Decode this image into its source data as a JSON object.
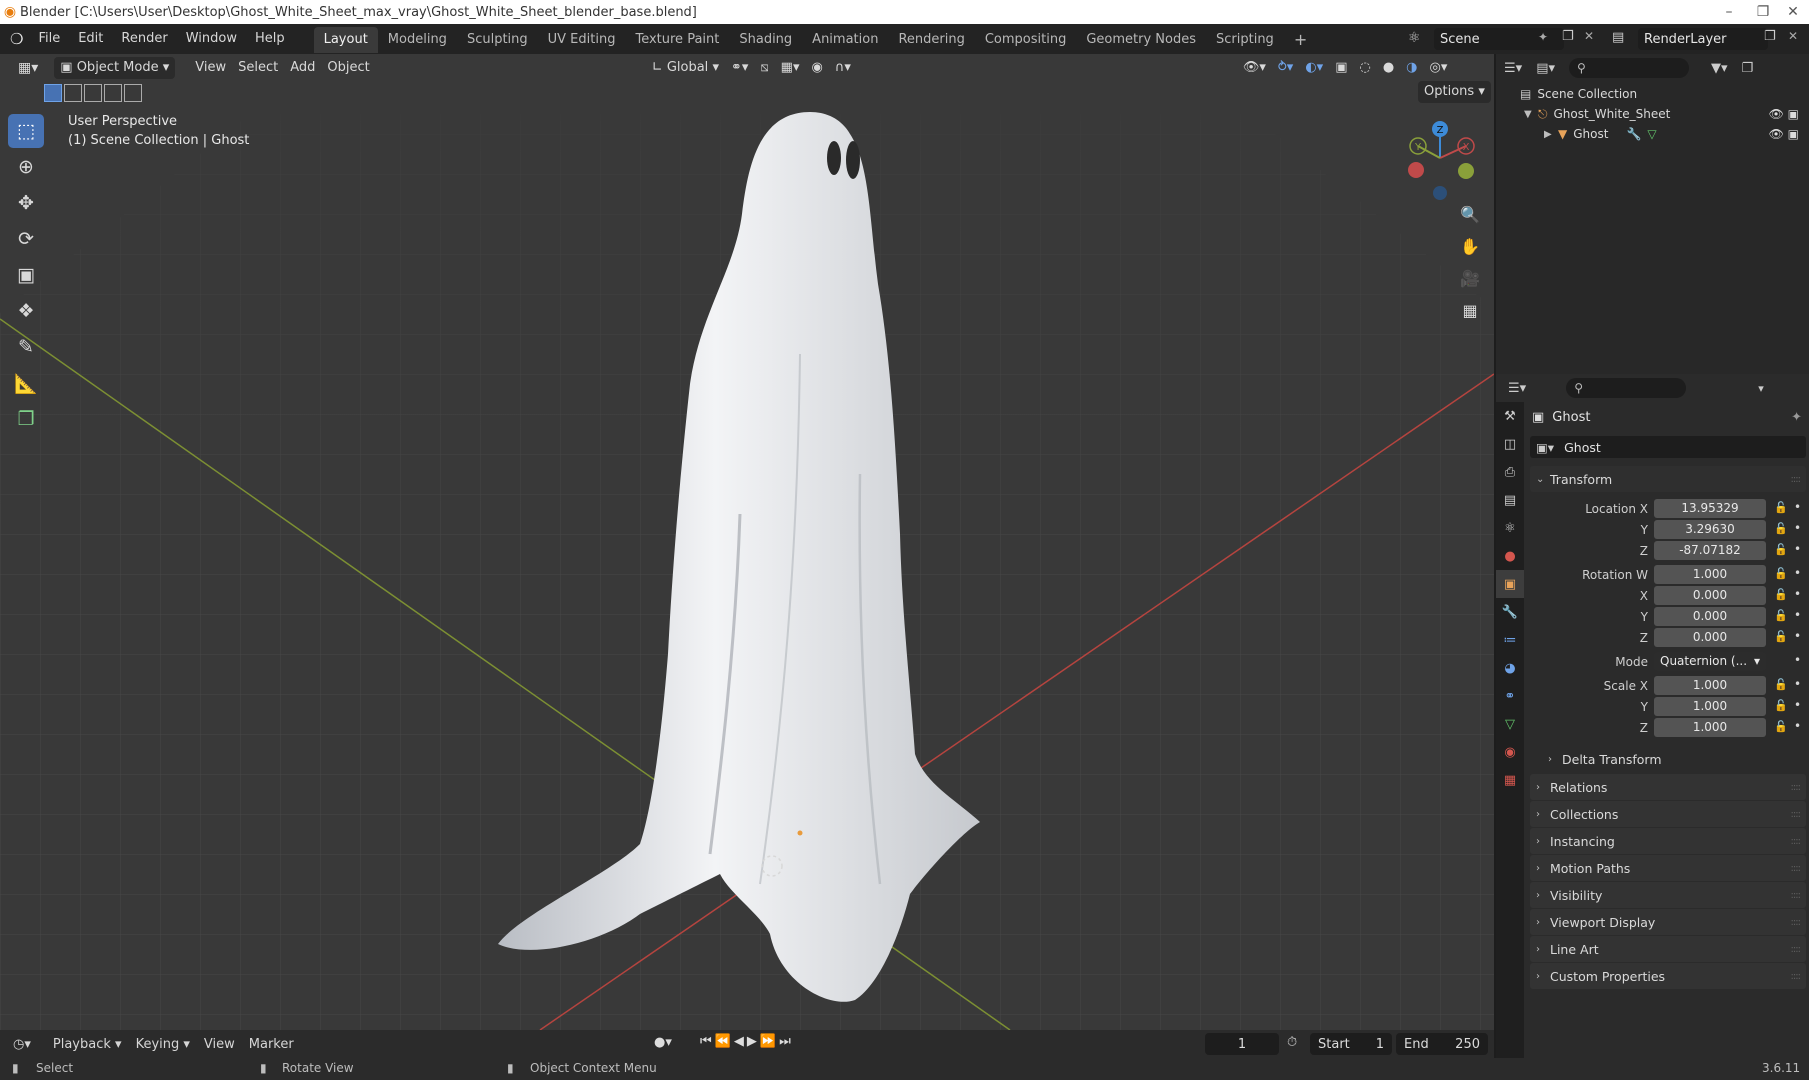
{
  "title_bar": {
    "title": "Blender [C:\\Users\\User\\Desktop\\Ghost_White_Sheet_max_vray\\Ghost_White_Sheet_blender_base.blend]",
    "minimize": "–",
    "maximize": "❐",
    "close": "✕"
  },
  "menu": {
    "items": [
      "File",
      "Edit",
      "Render",
      "Window",
      "Help"
    ],
    "workspaces": [
      "Layout",
      "Modeling",
      "Sculpting",
      "UV Editing",
      "Texture Paint",
      "Shading",
      "Animation",
      "Rendering",
      "Compositing",
      "Geometry Nodes",
      "Scripting"
    ],
    "active_workspace": "Layout",
    "add_workspace": "+",
    "scene": "Scene",
    "view_layer": "RenderLayer"
  },
  "viewport": {
    "mode": "Object Mode",
    "menus": [
      "View",
      "Select",
      "Add",
      "Object"
    ],
    "transform_orientation": "Global",
    "options": "Options",
    "overlay_line1": "User Perspective",
    "overlay_line2": "(1) Scene Collection | Ghost",
    "gizmo": {
      "z": "Z",
      "y": "Y",
      "x": "X"
    },
    "colors": {
      "x_axis": "#c04a4a",
      "y_axis": "#8aa03a",
      "z_axis": "#3d8bd8",
      "active_tool": "#4772b3"
    }
  },
  "timeline": {
    "menus": [
      "Playback",
      "Keying",
      "View",
      "Marker"
    ],
    "current_frame": "1",
    "start_label": "Start",
    "start_value": "1",
    "end_label": "End",
    "end_value": "250"
  },
  "status_bar": {
    "left": "Select",
    "middle": "Rotate View",
    "right": "Object Context Menu",
    "version": "3.6.11"
  },
  "outliner": {
    "root": "Scene Collection",
    "collection": "Ghost_White_Sheet",
    "object": "Ghost"
  },
  "properties": {
    "object_name": "Ghost",
    "data_name": "Ghost",
    "transform_header": "Transform",
    "location": {
      "label": "Location X",
      "x": "13.95329",
      "y": "3.29630",
      "z": "-87.07182"
    },
    "rotation": {
      "label": "Rotation W",
      "w": "1.000",
      "x": "0.000",
      "y": "0.000",
      "z": "0.000"
    },
    "mode_label": "Mode",
    "mode_value": "Quaternion (...",
    "scale": {
      "label": "Scale X",
      "x": "1.000",
      "y": "1.000",
      "z": "1.000"
    },
    "axis_labels": {
      "y": "Y",
      "z": "Z",
      "x": "X"
    },
    "delta_transform": "Delta Transform",
    "panels": [
      "Relations",
      "Collections",
      "Instancing",
      "Motion Paths",
      "Visibility",
      "Viewport Display",
      "Line Art",
      "Custom Properties"
    ]
  }
}
